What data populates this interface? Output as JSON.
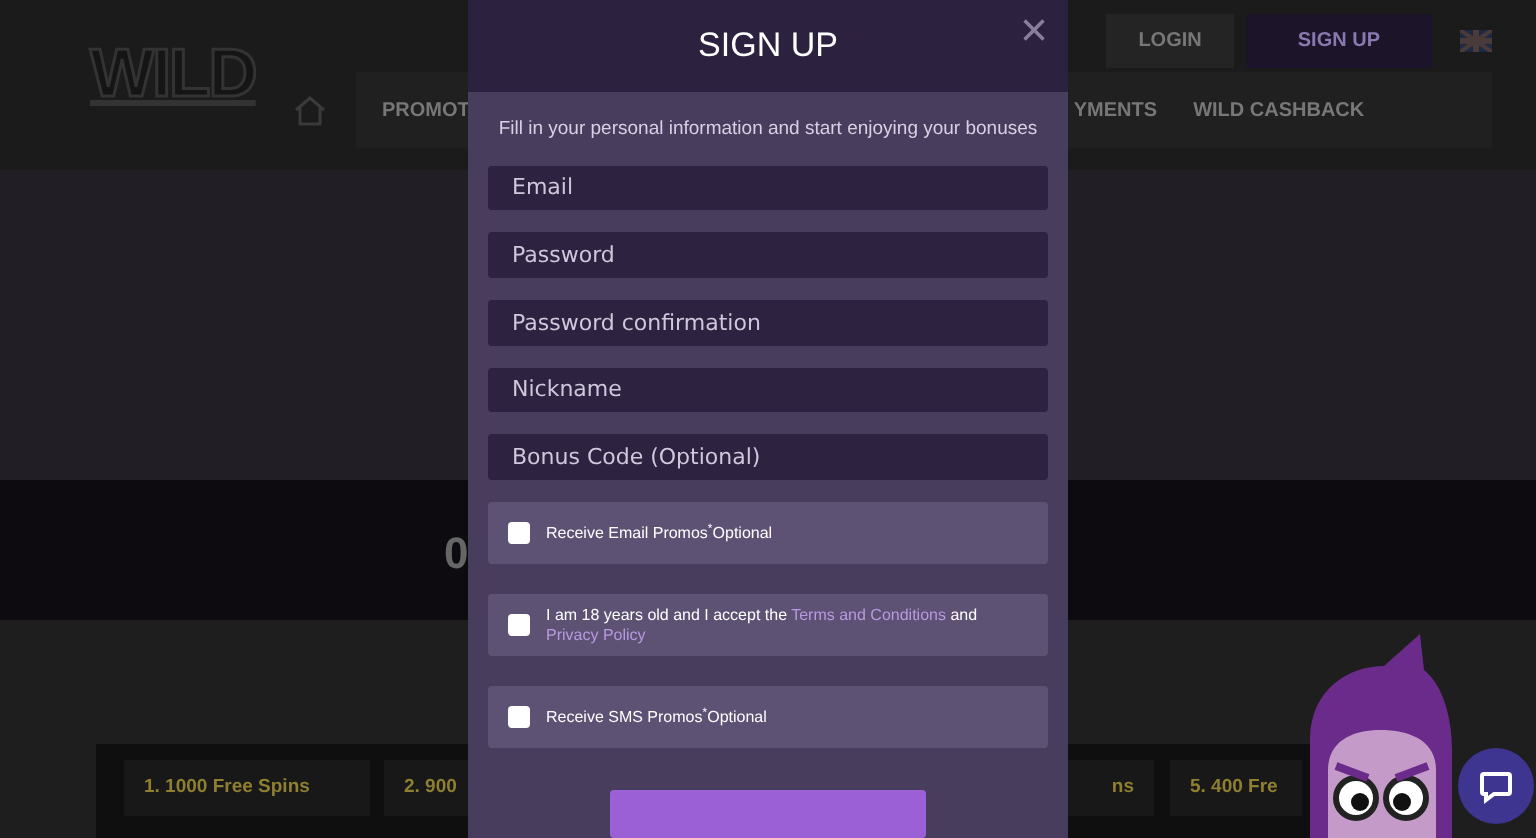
{
  "header": {
    "logo": "WILD",
    "top_links": [
      {
        "label": "LOGIN",
        "kind": "login"
      },
      {
        "label": "SIGN UP",
        "kind": "signup"
      }
    ],
    "nav": [
      "PROMOT",
      "YMENTS",
      "WILD CASHBACK"
    ]
  },
  "band": {
    "value": "0"
  },
  "offers": [
    "1. 1000 Free Spins",
    "2. 900",
    "ns",
    "5. 400 Fre"
  ],
  "modal": {
    "title": "SIGN UP",
    "close": "×",
    "intro": "Fill in your personal information and start enjoying your bonuses",
    "fields": [
      {
        "placeholder": "Email"
      },
      {
        "placeholder": "Password"
      },
      {
        "placeholder": "Password confirmation"
      },
      {
        "placeholder": "Nickname"
      },
      {
        "placeholder": "Bonus Code (Optional)"
      }
    ],
    "checkboxes": [
      {
        "checked": false,
        "parts": [
          {
            "text": "Receive Email Promos$^{*}$Optional",
            "link": false
          }
        ]
      },
      {
        "checked": false,
        "parts": [
          {
            "text": "I am 18 years old and I accept the",
            "link": false
          },
          {
            "text": "Terms and Conditions",
            "link": true
          },
          {
            "text": "and",
            "link": false
          },
          {
            "text": "Privacy Policy",
            "link": true
          }
        ]
      },
      {
        "checked": false,
        "parts": [
          {
            "text": "Receive SMS Promos$^{*}$Optional",
            "link": false
          }
        ]
      }
    ]
  }
}
